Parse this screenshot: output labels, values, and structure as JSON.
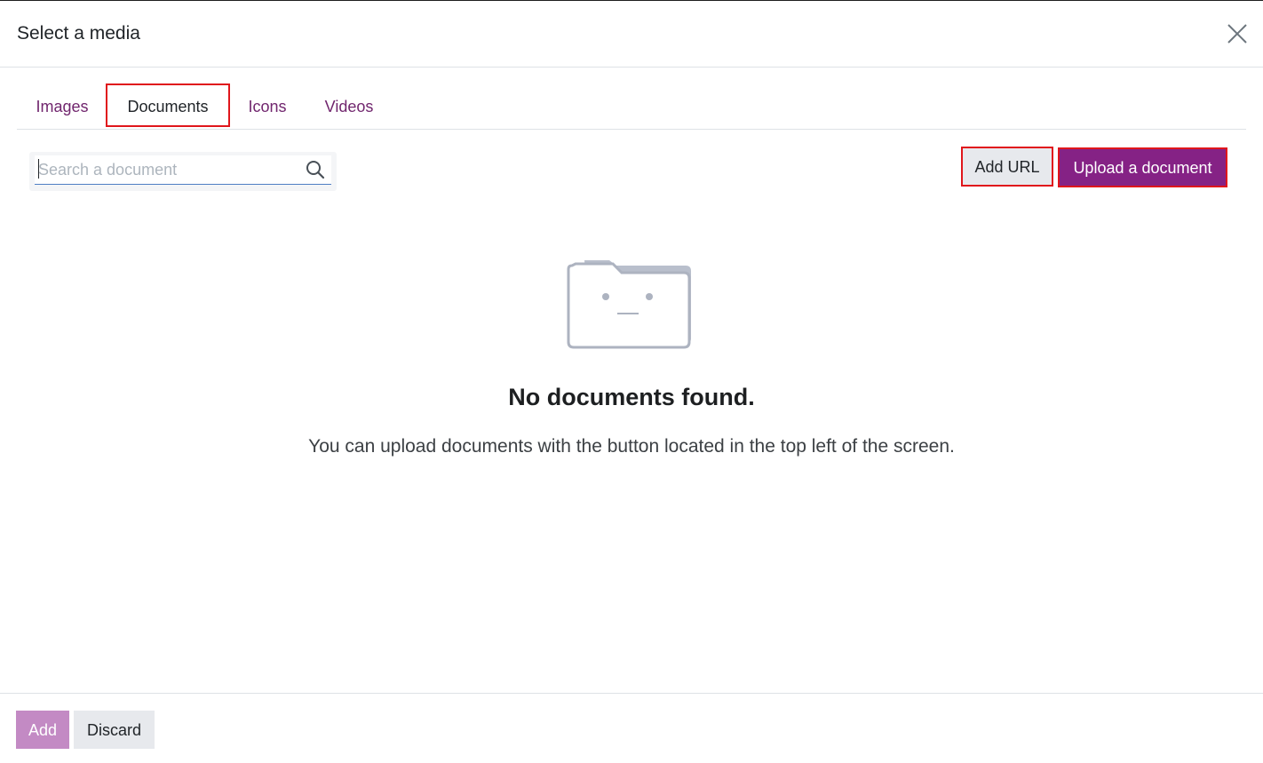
{
  "dialog": {
    "title": "Select a media"
  },
  "tabs": [
    {
      "label": "Images",
      "active": false
    },
    {
      "label": "Documents",
      "active": true
    },
    {
      "label": "Icons",
      "active": false
    },
    {
      "label": "Videos",
      "active": false
    }
  ],
  "search": {
    "placeholder": "Search a document",
    "value": ""
  },
  "toolbar": {
    "add_url_label": "Add URL",
    "upload_label": "Upload a document"
  },
  "empty_state": {
    "title": "No documents found.",
    "message": "You can upload documents with the button located in the top left of the screen."
  },
  "footer": {
    "add_label": "Add",
    "discard_label": "Discard"
  },
  "icons": {
    "close": "close-icon",
    "search": "search-icon",
    "empty": "empty-folder-icon"
  },
  "colors": {
    "brand": "#852285",
    "tab_link": "#71266e",
    "add_disabled": "#c38ac4",
    "secondary_button": "#e7e9ed",
    "highlight_border": "#e0161c"
  }
}
